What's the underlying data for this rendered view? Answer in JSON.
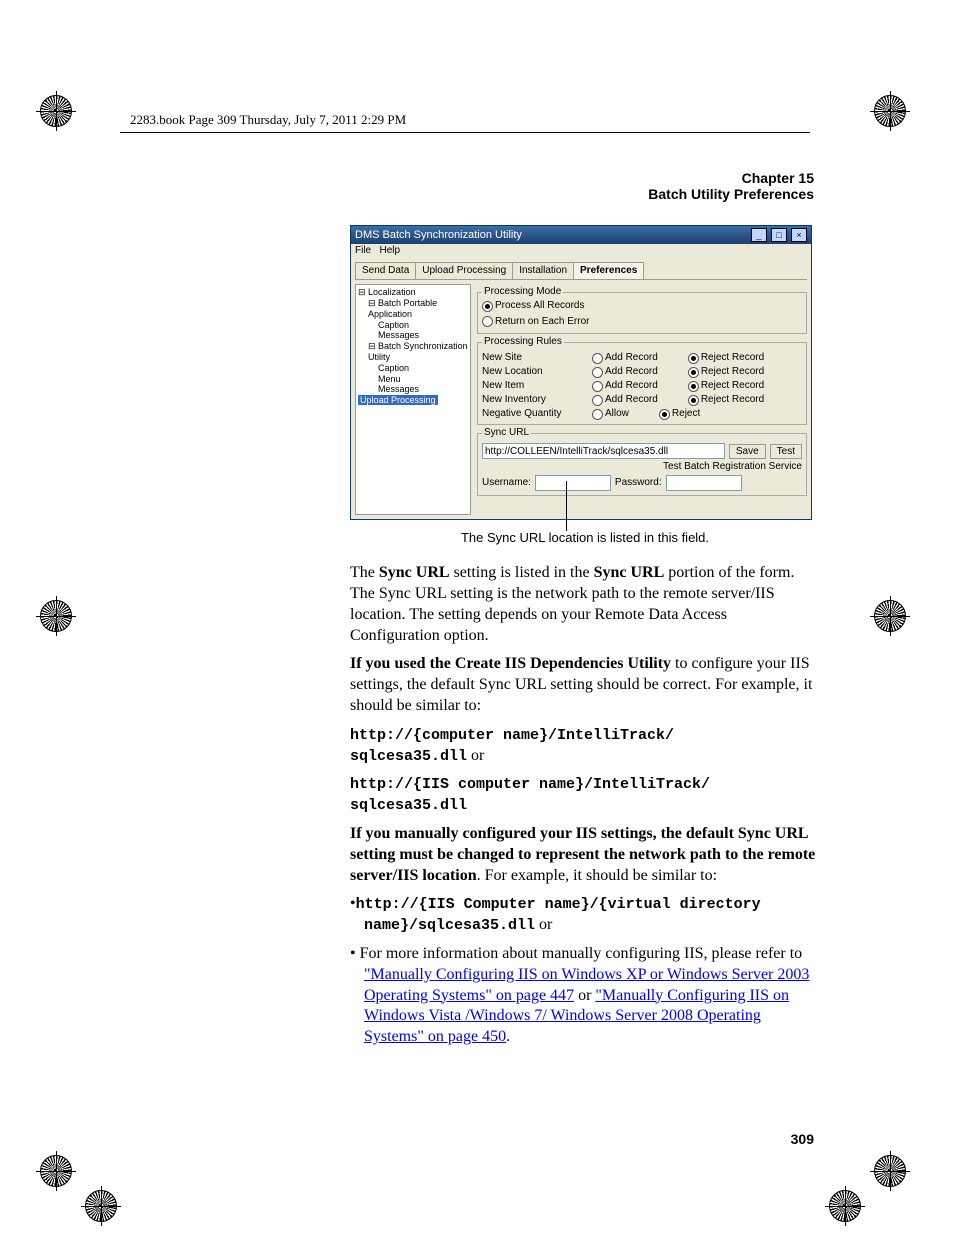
{
  "book_header": "2283.book  Page 309  Thursday, July 7, 2011  2:29 PM",
  "chapter": {
    "num": "Chapter 15",
    "title": "Batch Utility Preferences"
  },
  "win": {
    "title": "DMS Batch Synchronization Utility",
    "menu": {
      "file": "File",
      "help": "Help"
    },
    "tabs": {
      "send": "Send Data",
      "upload": "Upload Processing",
      "install": "Installation",
      "prefs": "Preferences"
    },
    "tree": {
      "root": "Localization",
      "n1": "Batch Portable Application",
      "n1a": "Caption",
      "n1b": "Messages",
      "n2": "Batch Synchronization Utility",
      "n2a": "Caption",
      "n2b": "Menu",
      "n2c": "Messages",
      "n3": "Upload Processing"
    },
    "pm": {
      "legend": "Processing Mode",
      "r1": "Process All Records",
      "r2": "Return on Each Error"
    },
    "pr": {
      "legend": "Processing Rules",
      "rows": [
        {
          "lbl": "New Site",
          "a": "Add Record",
          "b": "Reject Record"
        },
        {
          "lbl": "New Location",
          "a": "Add Record",
          "b": "Reject Record"
        },
        {
          "lbl": "New Item",
          "a": "Add Record",
          "b": "Reject Record"
        },
        {
          "lbl": "New Inventory",
          "a": "Add Record",
          "b": "Reject Record"
        },
        {
          "lbl": "Negative Quantity",
          "a": "Allow",
          "b": "Reject"
        }
      ]
    },
    "sync": {
      "legend": "Sync URL",
      "value": "http://COLLEEN/IntelliTrack/sqlcesa35.dll",
      "save": "Save",
      "test": "Test",
      "test_service": "Test Batch Registration Service",
      "user_lbl": "Username:",
      "pass_lbl": "Password:"
    }
  },
  "caption": "The Sync URL location is listed in this field.",
  "body": {
    "p1a": "The ",
    "p1b": "Sync URL",
    "p1c": " setting is listed in the ",
    "p1d": "Sync URL",
    "p1e": " portion of the form. The Sync URL setting is the network path to the remote server/IIS location. The setting depends on your Remote Data Access Configuration option.",
    "p2a": "If you used the Create IIS Dependencies Utility",
    "p2b": " to configure your IIS settings, the default Sync URL setting should be correct. For example, it should be similar to:",
    "code1a": "http://{computer name}/IntelliTrack/",
    "code1b": "sqlcesa35.dll",
    "or1": "  or",
    "code2a": "http://{IIS computer name}/IntelliTrack/",
    "code2b": "sqlcesa35.dll",
    "p3a": "If you manually configured your IIS settings, the default Sync URL setting must be changed to represent the network path to the remote server/IIS location",
    "p3b": ". For example, it should be similar to:",
    "bullet1_dot": "•",
    "code3a": "http://{IIS Computer name}/{virtual directory name}/sqlcesa35.dll",
    "or2": " or",
    "bullet2_dot": "•",
    "b2_pre": " For more information about manually configuring IIS, please refer to ",
    "link1": "\"Manually Configuring IIS on Windows XP or Windows Server 2003 Operating Systems\" on page 447",
    "b2_mid": " or ",
    "link2": "\"Manually Configuring IIS on Windows Vista /Windows 7/ Windows Server 2008 Operating Systems\" on page 450",
    "b2_end": "."
  },
  "page_num": "309"
}
